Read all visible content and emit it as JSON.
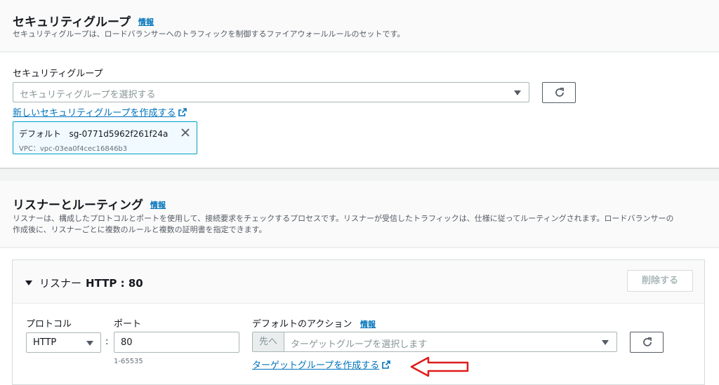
{
  "security_group": {
    "title": "セキュリティグループ",
    "info": "情報",
    "description": "セキュリティグループは、ロードバランサーへのトラフィックを制御するファイアウォールルールのセットです。",
    "field_label": "セキュリティグループ",
    "select_placeholder": "セキュリティグループを選択する",
    "create_link": "新しいセキュリティグループを作成する",
    "selected_token": {
      "name": "デフォルト",
      "id": "sg-0771d5962f261f24a",
      "vpc": "VPC：vpc-03ea0f4cec16846b3"
    }
  },
  "listener_routing": {
    "title": "リスナーとルーティング",
    "info": "情報",
    "description_line1": "リスナーは、構成したプロトコルとポートを使用して、接続要求をチェックするプロセスです。リスナーが受信したトラフィックは、仕様に従ってルーティングされます。ロードバランサーの",
    "description_line2": "作成後に、リスナーごとに複数のルールと複数の証明書を指定できます。",
    "listener": {
      "title_prefix": "リスナー",
      "title_value": "HTTP : 80",
      "delete_label": "削除する",
      "protocol_label": "プロトコル",
      "protocol_value": "HTTP",
      "colon": ":",
      "port_label": "ポート",
      "port_value": "80",
      "port_hint": "1-65535",
      "action_label": "デフォルトのアクション",
      "action_info": "情報",
      "action_prefix": "先へ",
      "action_placeholder": "ターゲットグループを選択します",
      "create_target_link": "ターゲットグループを作成する"
    }
  },
  "colors": {
    "link": "#0073bb",
    "annotation_arrow": "#e01b1b",
    "token_border": "#00a1c9"
  }
}
